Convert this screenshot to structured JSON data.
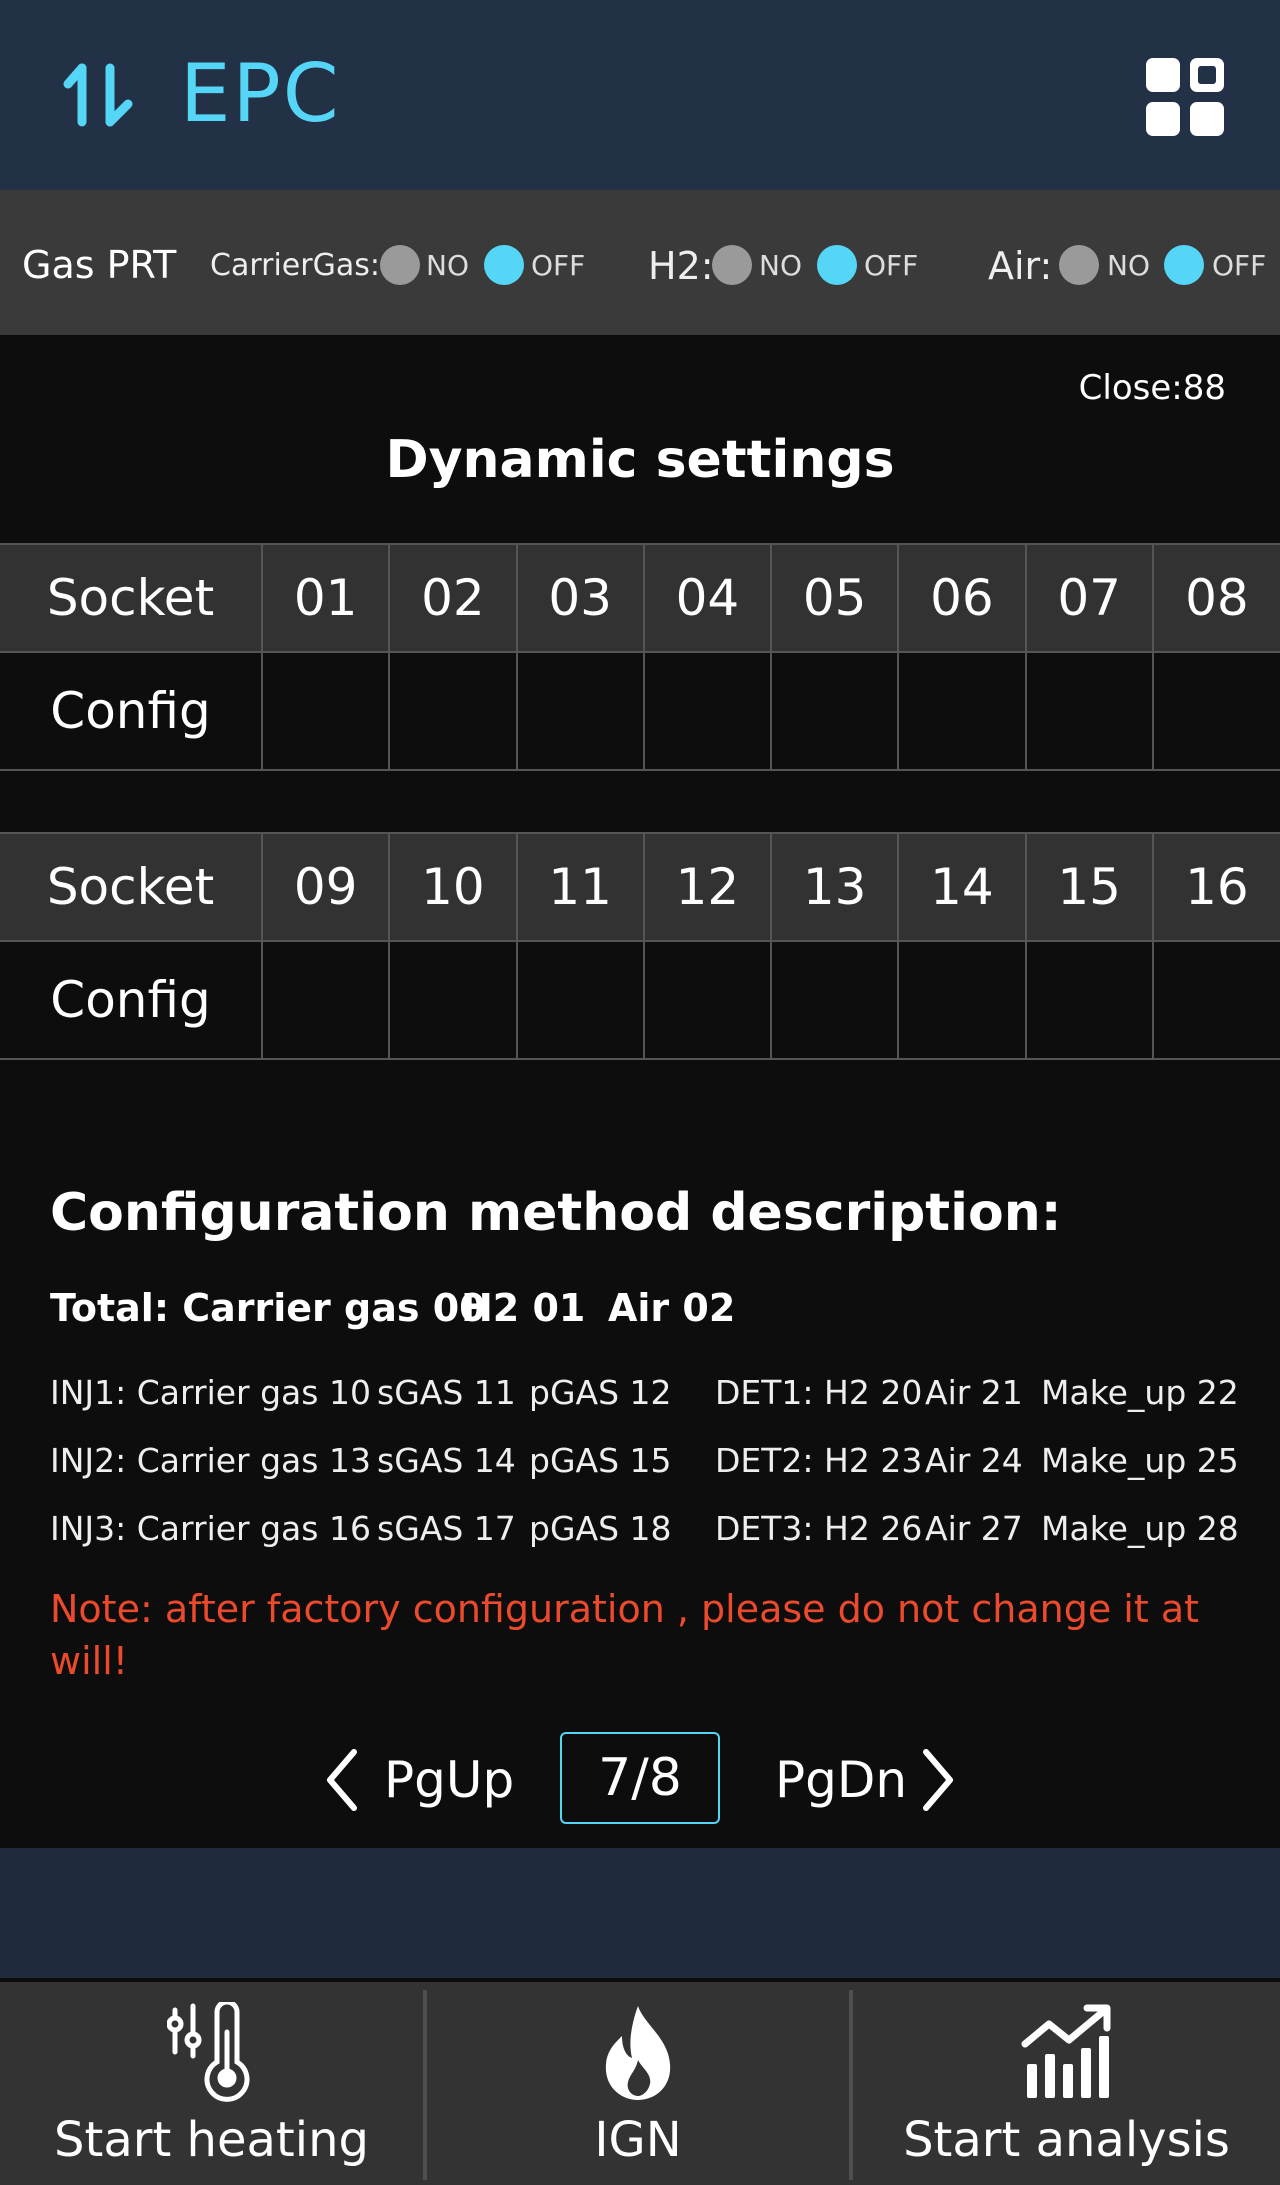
{
  "header": {
    "title": "EPC",
    "logo_icon": "sort-arrows-icon",
    "menu_icon": "apps-grid-icon"
  },
  "gas_prt": {
    "title": "Gas PRT",
    "groups": [
      {
        "label": "CarrierGas:",
        "no": "NO",
        "off": "OFF",
        "selected": "OFF"
      },
      {
        "label": "H2:",
        "no": "NO",
        "off": "OFF",
        "selected": "OFF"
      },
      {
        "label": "Air:",
        "no": "NO",
        "off": "OFF",
        "selected": "OFF"
      }
    ]
  },
  "close_label": "Close:88",
  "dynamic_title": "Dynamic settings",
  "tables": [
    {
      "socket_label": "Socket",
      "config_label": "Config",
      "sockets": [
        "01",
        "02",
        "03",
        "04",
        "05",
        "06",
        "07",
        "08"
      ],
      "configs": [
        "",
        "",
        "",
        "",
        "",
        "",
        "",
        ""
      ]
    },
    {
      "socket_label": "Socket",
      "config_label": "Config",
      "sockets": [
        "09",
        "10",
        "11",
        "12",
        "13",
        "14",
        "15",
        "16"
      ],
      "configs": [
        "",
        "",
        "",
        "",
        "",
        "",
        "",
        ""
      ]
    }
  ],
  "description": {
    "title": "Configuration method description:",
    "total": [
      "Total: Carrier gas 00",
      "H2 01",
      "Air 02"
    ],
    "rows": [
      [
        "INJ1: Carrier gas 10",
        "sGAS 11",
        "pGAS 12",
        "DET1: H2 20",
        "Air 21",
        "Make_up 22"
      ],
      [
        "INJ2: Carrier gas 13",
        "sGAS 14",
        "pGAS 15",
        "DET2: H2 23",
        "Air 24",
        "Make_up 25"
      ],
      [
        "INJ3: Carrier gas 16",
        "sGAS 17",
        "pGAS 18",
        "DET3: H2 26",
        "Air 27",
        "Make_up 28"
      ]
    ],
    "note": "Note: after factory configuration , please do not change it at will!"
  },
  "pager": {
    "prev": "PgUp",
    "page": "7/8",
    "next": "PgDn"
  },
  "footer": [
    {
      "label": "Start heating",
      "icon": "thermometer-sliders-icon"
    },
    {
      "label": "IGN",
      "icon": "flame-icon"
    },
    {
      "label": "Start analysis",
      "icon": "bar-chart-trend-icon"
    }
  ],
  "colors": {
    "accent": "#55d6f6",
    "header_bg": "#233147",
    "note": "#ec4a2c"
  }
}
